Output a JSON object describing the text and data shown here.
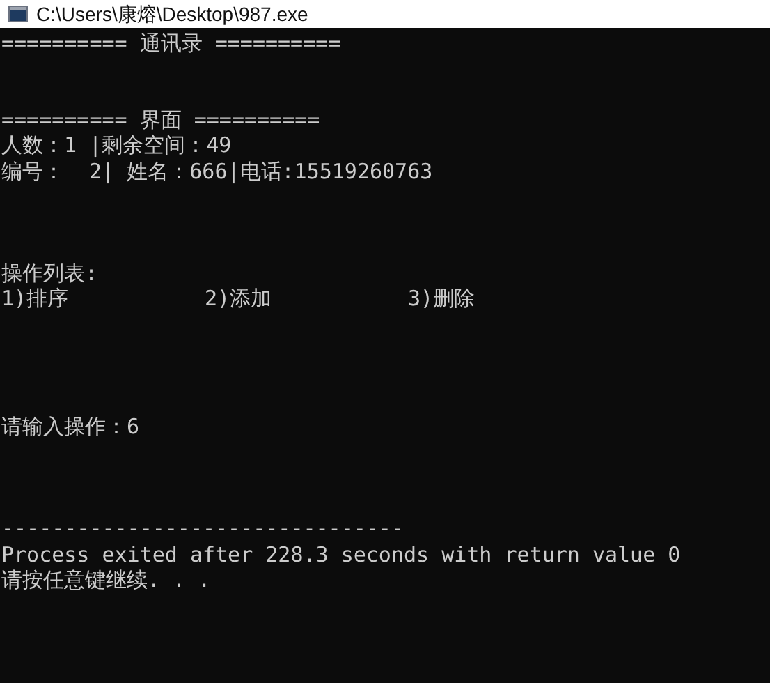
{
  "window": {
    "title": "C:\\Users\\康熔\\Desktop\\987.exe"
  },
  "console": {
    "lines": [
      {
        "kind": "text",
        "text": "========== 通讯录 =========="
      },
      {
        "kind": "text",
        "text": "========== 界面 =========="
      },
      {
        "kind": "text",
        "text": "人数：1 |剩余空间：49"
      },
      {
        "kind": "text",
        "text": "编号：  2| 姓名：666|电话:15519260763"
      },
      {
        "kind": "text",
        "text": "操作列表:"
      },
      {
        "kind": "columns",
        "items": [
          "1)排序",
          "2)添加",
          "3)删除"
        ]
      },
      {
        "kind": "text",
        "text": "请输入操作：6"
      },
      {
        "kind": "text",
        "text": "--------------------------------"
      },
      {
        "kind": "text",
        "text": "Process exited after 228.3 seconds with return value 0"
      },
      {
        "kind": "text",
        "text": "请按任意键继续. . ."
      }
    ]
  }
}
